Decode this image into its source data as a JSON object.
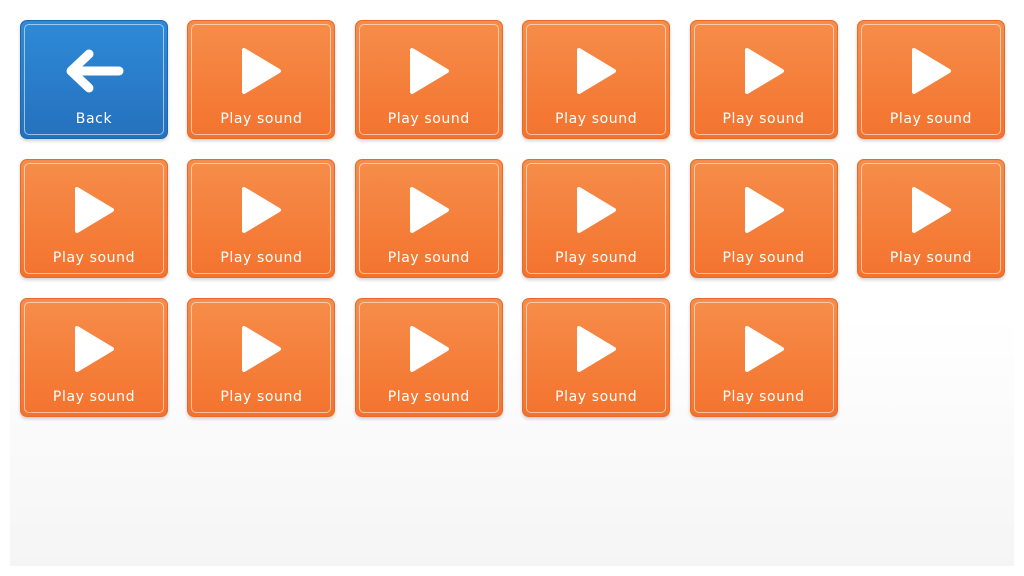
{
  "back_tile": {
    "label": "Back",
    "icon": "arrow-left-icon",
    "color": "#2e7fcf"
  },
  "sound_tiles": [
    {
      "label": "Play sound",
      "icon": "play-icon"
    },
    {
      "label": "Play sound",
      "icon": "play-icon"
    },
    {
      "label": "Play sound",
      "icon": "play-icon"
    },
    {
      "label": "Play sound",
      "icon": "play-icon"
    },
    {
      "label": "Play sound",
      "icon": "play-icon"
    },
    {
      "label": "Play sound",
      "icon": "play-icon"
    },
    {
      "label": "Play sound",
      "icon": "play-icon"
    },
    {
      "label": "Play sound",
      "icon": "play-icon"
    },
    {
      "label": "Play sound",
      "icon": "play-icon"
    },
    {
      "label": "Play sound",
      "icon": "play-icon"
    },
    {
      "label": "Play sound",
      "icon": "play-icon"
    },
    {
      "label": "Play sound",
      "icon": "play-icon"
    },
    {
      "label": "Play sound",
      "icon": "play-icon"
    },
    {
      "label": "Play sound",
      "icon": "play-icon"
    },
    {
      "label": "Play sound",
      "icon": "play-icon"
    },
    {
      "label": "Play sound",
      "icon": "play-icon"
    }
  ],
  "colors": {
    "tile_orange": "#f47b36",
    "tile_blue": "#2e7fcf",
    "text": "#ffffff"
  }
}
